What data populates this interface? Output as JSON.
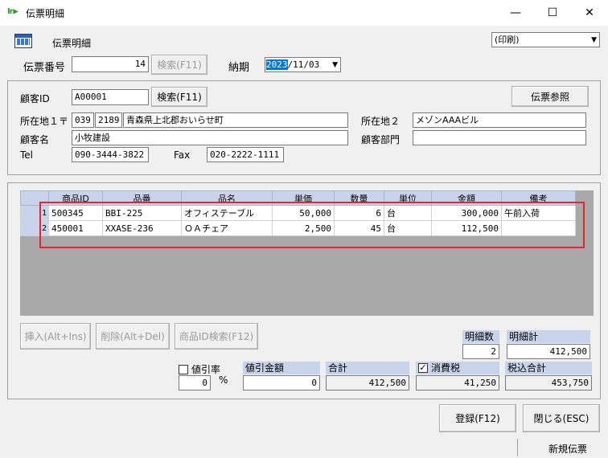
{
  "window": {
    "app_logo": "In▸",
    "title": "伝票明細",
    "minimize": "—",
    "maximize": "☐",
    "close": "✕"
  },
  "header": {
    "form_title": "伝票明細",
    "print_select": "(印刷)",
    "slip_no_label": "伝票番号",
    "slip_no": "14",
    "search_btn": "検索(F11)",
    "delivery_label": "納期",
    "delivery_year": "2023",
    "delivery_rest": "/11/03"
  },
  "customer": {
    "id_label": "顧客ID",
    "id_value": "A00001",
    "search_btn": "検索(F11)",
    "slip_ref_btn": "伝票参照",
    "addr1_label": "所在地１〒",
    "zip1": "039",
    "zip2": "2189",
    "addr1": "青森県上北郡おいらせ町",
    "addr2_label": "所在地２",
    "addr2": "メゾンAAAビル",
    "name_label": "顧客名",
    "name": "小牧建設",
    "dept_label": "顧客部門",
    "dept": "",
    "tel_label": "Tel",
    "tel": "090-3444-3822",
    "fax_label": "Fax",
    "fax": "020-2222-1111"
  },
  "grid": {
    "columns": [
      "商品ID",
      "品番",
      "品名",
      "単価",
      "数量",
      "単位",
      "金額",
      "備考"
    ],
    "rows": [
      {
        "rownum": "1",
        "id": "500345",
        "partno": "BBI-225",
        "name": "オフィステーブル",
        "price": "50,000",
        "qty": "6",
        "unit": "台",
        "amount": "300,000",
        "note": "午前入荷"
      },
      {
        "rownum": "2",
        "id": "450001",
        "partno": "XXASE-236",
        "name": "ＯＡチェア",
        "price": "2,500",
        "qty": "45",
        "unit": "台",
        "amount": "112,500",
        "note": ""
      }
    ]
  },
  "actions": {
    "insert": "挿入(Alt+Ins)",
    "delete": "削除(Alt+Del)",
    "product_search": "商品ID検索(F12)"
  },
  "totals": {
    "line_count_label": "明細数",
    "line_count": "2",
    "line_total_label": "明細計",
    "line_total": "412,500",
    "discount_rate_label": "値引率",
    "discount_rate": "0",
    "percent": "%",
    "discount_amount_label": "値引金額",
    "discount_amount": "0",
    "total_label": "合計",
    "total": "412,500",
    "tax_label": "消費税",
    "tax": "41,250",
    "tax_checked": "✓",
    "grand_total_label": "税込合計",
    "grand_total": "453,750"
  },
  "footer": {
    "register_btn": "登録(F12)",
    "close_btn": "閉じる(ESC)",
    "new_slip": "新規伝票"
  },
  "colors": {
    "highlight": "#e8242c",
    "grid_header": "#c8d4ec",
    "selection": "#0078d7"
  }
}
